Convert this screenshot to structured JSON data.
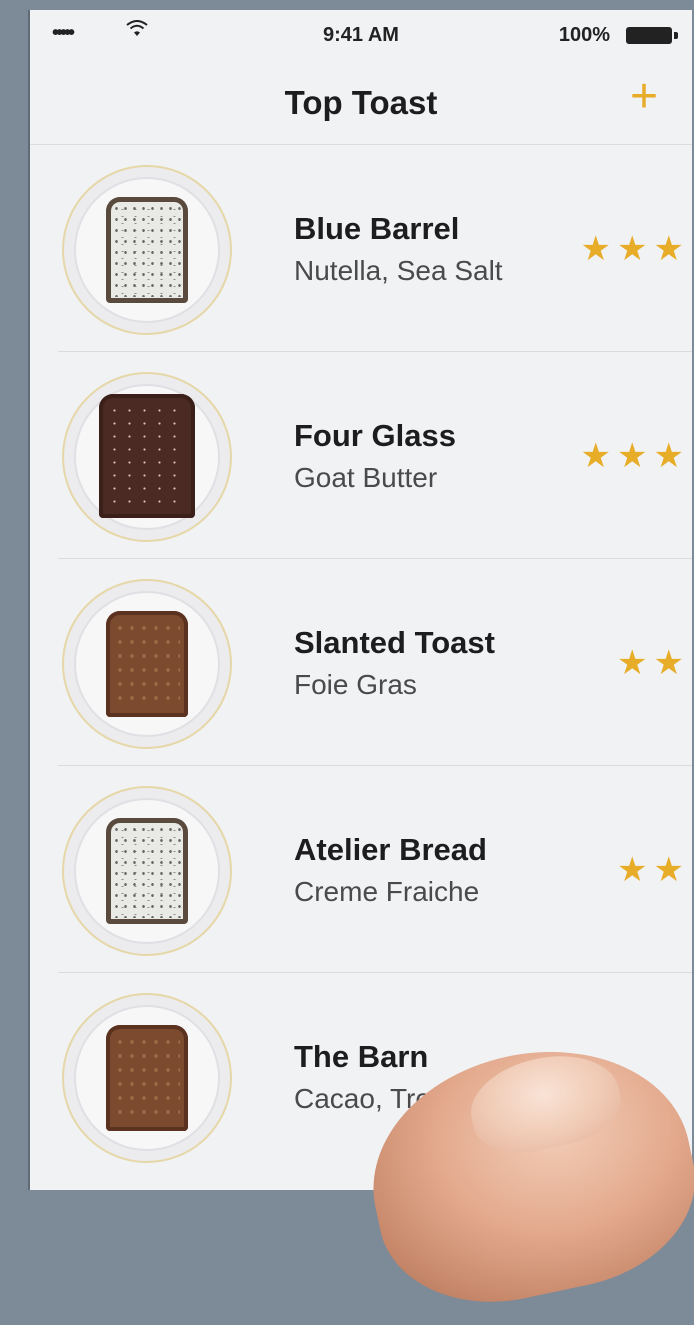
{
  "status_bar": {
    "signal": "•••••",
    "time": "9:41 AM",
    "battery": "100%"
  },
  "nav": {
    "title": "Top Toast",
    "add_label": "+"
  },
  "toasts": [
    {
      "name": "Blue Barrel",
      "topping": "Nutella, Sea Salt",
      "stars": "★★★",
      "rating": 3,
      "style": "white"
    },
    {
      "name": "Four Glass",
      "topping": "Goat Butter",
      "stars": "★★★",
      "rating": 3,
      "style": "choco"
    },
    {
      "name": "Slanted Toast",
      "topping": "Foie Gras",
      "stars": "★★",
      "rating": 2,
      "style": "brown"
    },
    {
      "name": "Atelier Bread",
      "topping": "Creme Fraiche",
      "stars": "★★",
      "rating": 2,
      "style": "white"
    },
    {
      "name": "The Barn",
      "topping": "Cacao, Trout",
      "stars": "",
      "rating": null,
      "style": "brown"
    }
  ],
  "colors": {
    "accent": "#e7ac28",
    "background": "#f1f2f4"
  }
}
